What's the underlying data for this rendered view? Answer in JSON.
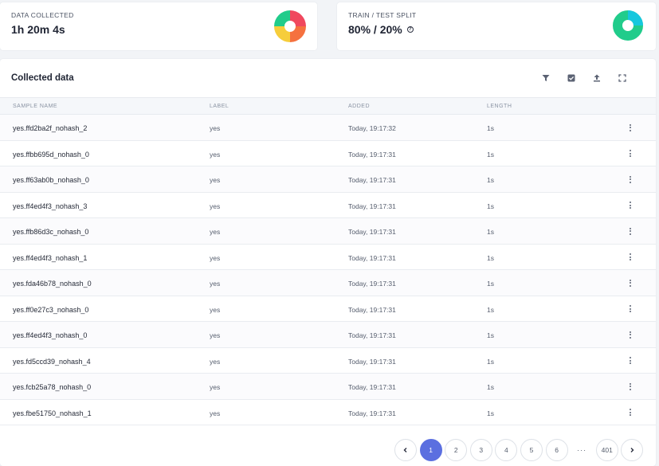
{
  "stats": {
    "collected": {
      "title": "DATA COLLECTED",
      "value": "1h 20m 4s"
    },
    "split": {
      "title": "TRAIN / TEST SPLIT",
      "value": "80% / 20%",
      "help_icon": "question-circle-icon"
    }
  },
  "data_panel": {
    "title": "Collected data",
    "tools": [
      "filter-icon",
      "select-icon",
      "upload-icon",
      "fullscreen-icon"
    ]
  },
  "table": {
    "columns": [
      "SAMPLE NAME",
      "LABEL",
      "ADDED",
      "LENGTH"
    ],
    "rows": [
      {
        "name": "yes.ffd2ba2f_nohash_2",
        "label": "yes",
        "added": "Today, 19:17:32",
        "length": "1s"
      },
      {
        "name": "yes.ffbb695d_nohash_0",
        "label": "yes",
        "added": "Today, 19:17:31",
        "length": "1s"
      },
      {
        "name": "yes.ff63ab0b_nohash_0",
        "label": "yes",
        "added": "Today, 19:17:31",
        "length": "1s"
      },
      {
        "name": "yes.ff4ed4f3_nohash_3",
        "label": "yes",
        "added": "Today, 19:17:31",
        "length": "1s"
      },
      {
        "name": "yes.ffb86d3c_nohash_0",
        "label": "yes",
        "added": "Today, 19:17:31",
        "length": "1s"
      },
      {
        "name": "yes.ff4ed4f3_nohash_1",
        "label": "yes",
        "added": "Today, 19:17:31",
        "length": "1s"
      },
      {
        "name": "yes.fda46b78_nohash_0",
        "label": "yes",
        "added": "Today, 19:17:31",
        "length": "1s"
      },
      {
        "name": "yes.ff0e27c3_nohash_0",
        "label": "yes",
        "added": "Today, 19:17:31",
        "length": "1s"
      },
      {
        "name": "yes.ff4ed4f3_nohash_0",
        "label": "yes",
        "added": "Today, 19:17:31",
        "length": "1s"
      },
      {
        "name": "yes.fd5ccd39_nohash_4",
        "label": "yes",
        "added": "Today, 19:17:31",
        "length": "1s"
      },
      {
        "name": "yes.fcb25a78_nohash_0",
        "label": "yes",
        "added": "Today, 19:17:31",
        "length": "1s"
      },
      {
        "name": "yes.fbe51750_nohash_1",
        "label": "yes",
        "added": "Today, 19:17:31",
        "length": "1s"
      }
    ]
  },
  "pagination": {
    "prev_icon": "chevron-left-icon",
    "next_icon": "chevron-right-icon",
    "pages": [
      "1",
      "2",
      "3",
      "4",
      "5",
      "6"
    ],
    "active": "1",
    "ellipsis": "···",
    "last": "401"
  },
  "colors": {
    "accent": "#5b6fe0",
    "donut_red": "#f0485e",
    "donut_orange": "#f5713f",
    "donut_yellow": "#f6cd3b",
    "donut_green": "#21cc8b",
    "donut_cyan": "#16c7de"
  }
}
